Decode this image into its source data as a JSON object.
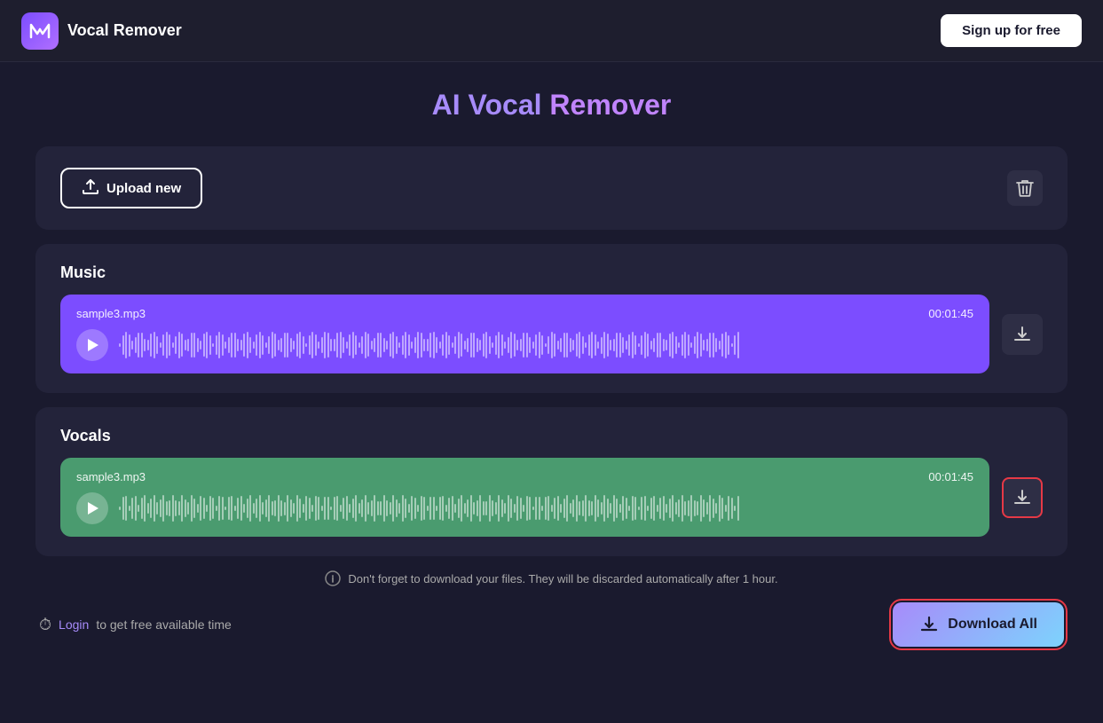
{
  "header": {
    "logo_letter": "m",
    "app_name": "Vocal Remover",
    "signup_label": "Sign up for free"
  },
  "page": {
    "title_ai": "AI Vocal",
    "title_rest": " Remover"
  },
  "upload_bar": {
    "upload_label": "Upload new",
    "trash_icon": "🗑"
  },
  "music_section": {
    "label": "Music",
    "track_name": "sample3.mp3",
    "track_time": "00:01:45",
    "download_icon": "⬇"
  },
  "vocals_section": {
    "label": "Vocals",
    "track_name": "sample3.mp3",
    "track_time": "00:01:45",
    "download_icon": "⬇"
  },
  "info_message": "Don't forget to download your files. They will be discarded automatically after 1 hour.",
  "footer": {
    "clock_icon": "⏱",
    "login_text": " to get free available time",
    "login_label": "Login",
    "download_all_label": "Download All"
  }
}
